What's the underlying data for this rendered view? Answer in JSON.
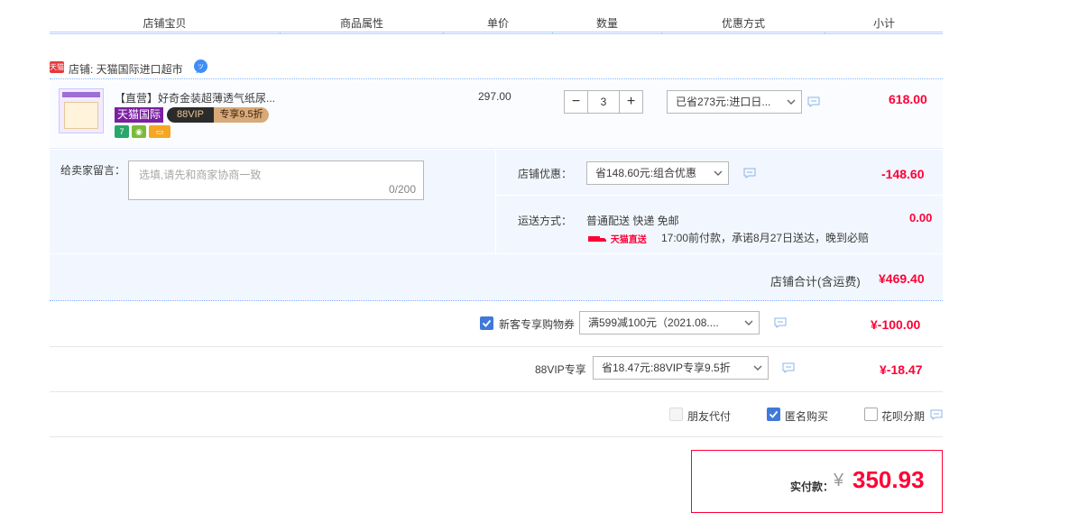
{
  "header": {
    "columns": [
      "店铺宝贝",
      "商品属性",
      "单价",
      "数量",
      "优惠方式",
      "小计"
    ]
  },
  "shop": {
    "badge": "天猫",
    "label": "店铺: 天猫国际进口超市"
  },
  "item": {
    "title": "【直营】好奇金装超薄透气纸尿...",
    "tag_intl": "天猫国际",
    "tag_vip_left": "88VIP",
    "tag_vip_right": "专享9.5折",
    "unit_price": "297.00",
    "qty_minus": "−",
    "qty_value": "3",
    "qty_plus": "+",
    "promo_select": "已省273元:进口日...",
    "subtotal": "618.00"
  },
  "details": {
    "note_label": "给卖家留言：",
    "note_placeholder": "选填,请先和商家协商一致",
    "note_counter": "0/200",
    "shop_discount_label": "店铺优惠：",
    "shop_discount_select": "省148.60元:组合优惠",
    "shop_discount_amount": "-148.60",
    "shipping_label": "运送方式：",
    "shipping_method": "普通配送 快递 免邮",
    "shipping_fee": "0.00",
    "express_brand": "天猫直送",
    "delivery_promise": "17:00前付款，承诺8月27日送达，晚到必赔",
    "shop_total_label": "店铺合计(含运费)",
    "shop_total": "¥469.40"
  },
  "coupon": {
    "label": "新客专享购物券",
    "select": "满599减100元（2021.08....",
    "amount": "¥-100.00",
    "checked": true
  },
  "vip": {
    "label": "88VIP专享",
    "select": "省18.47元:88VIP专享9.5折",
    "amount": "¥-18.47"
  },
  "options": {
    "friend_pay": "朋友代付",
    "anonymous": "匿名购买",
    "huabei": "花呗分期"
  },
  "payment": {
    "label": "实付款：",
    "currency": "¥",
    "amount": "350.93"
  },
  "colors": {
    "accent_red": "#ff0036",
    "header_line": "#b2d1ff",
    "panel_bg": "#f2f7ff",
    "checkbox_blue": "#3f79d9"
  }
}
